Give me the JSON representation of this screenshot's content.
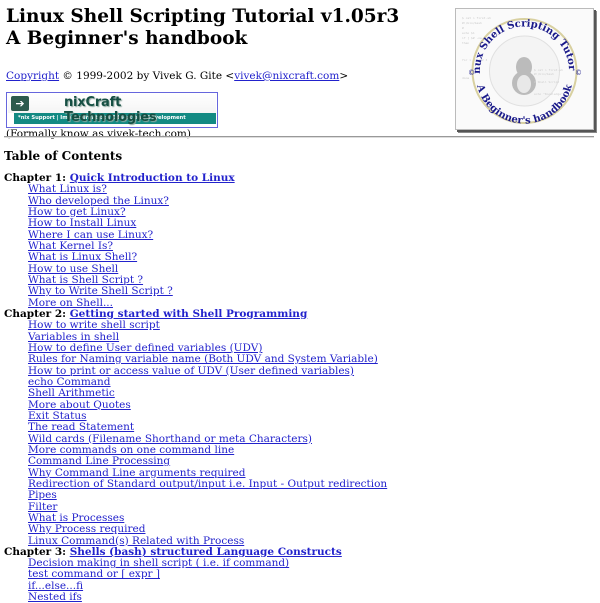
{
  "header": {
    "title_line1": "Linux Shell Scripting Tutorial v1.05r3",
    "title_line2": "A Beginner's handbook",
    "copyright_link": "Copyright",
    "copyright_text": " © 1999-2002 by Vivek G. Gite <",
    "email_link": "vivek@nixcraft.com",
    "email_suffix": ">",
    "banner": {
      "title": "nixCraft Technologies",
      "subtitle": "*nix Support | Implementation | Education | Development",
      "icon": "arrow-right-icon"
    },
    "formerly": "(Formally know as vivek-tech.com)"
  },
  "cover": {
    "ring_top": "Linux Shell Scripting Tutorial",
    "ring_bottom": "A Beginner's handbook",
    "icon": "tux-penguin-icon"
  },
  "toc": {
    "title": "Table of Contents",
    "chapters": [
      {
        "label": "Chapter 1: ",
        "link": "Quick Introduction to Linux",
        "items": [
          "What Linux is?",
          "Who developed the Linux?",
          "How to get Linux?",
          "How to Install Linux",
          "Where I can use Linux?",
          "What Kernel Is?",
          "What is Linux Shell?",
          "How to use Shell",
          "What is Shell Script ?",
          "Why to Write Shell Script ?",
          "More on Shell..."
        ]
      },
      {
        "label": "Chapter 2: ",
        "link": "Getting started with Shell Programming",
        "items": [
          "How to write shell script",
          "Variables in shell",
          "How to define User defined variables (UDV)",
          "Rules for Naming variable name (Both UDV and System Variable)",
          "How to print or access value of UDV (User defined variables)",
          "echo Command",
          "Shell Arithmetic",
          "More about Quotes",
          "Exit Status",
          "The read Statement",
          "Wild cards (Filename Shorthand or meta Characters)",
          "More commands on one command line",
          "Command Line Processing",
          "Why Command Line arguments required",
          "Redirection of Standard output/input i.e. Input - Output redirection",
          "Pipes",
          "Filter",
          "What is Processes",
          "Why Process required",
          "Linux Command(s) Related with Process"
        ]
      },
      {
        "label": "Chapter 3: ",
        "link": "Shells (bash) structured Language Constructs",
        "items": [
          "Decision making in shell script ( i.e. if command)",
          "test command or [ expr ]",
          "if...else...fi",
          "Nested ifs"
        ]
      }
    ]
  }
}
